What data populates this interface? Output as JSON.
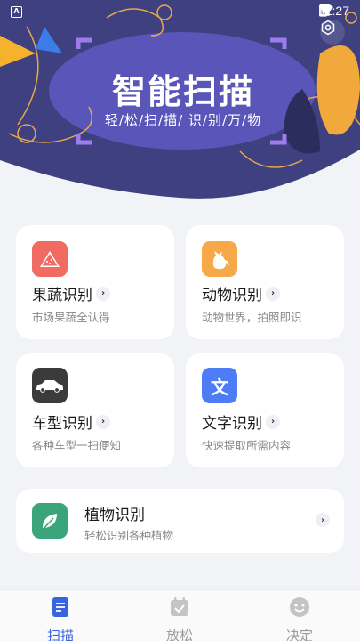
{
  "status": {
    "time": "11:27"
  },
  "hero": {
    "title": "智能扫描",
    "subtitle": "轻/松/扫/描/ 识/别/万/物"
  },
  "cards": [
    {
      "title": "果蔬识别",
      "desc": "市场果蔬全认得",
      "icon": "watermelon-icon",
      "color": "#f26b63"
    },
    {
      "title": "动物识别",
      "desc": "动物世界，拍照即识",
      "icon": "cat-icon",
      "color": "#f7a94a"
    },
    {
      "title": "车型识别",
      "desc": "各种车型一扫便知",
      "icon": "car-icon",
      "color": "#3b3b3b"
    },
    {
      "title": "文字识别",
      "desc": "快速提取所需内容",
      "icon": "text-icon",
      "color": "#4e7cf6",
      "glyph": "文"
    },
    {
      "title": "植物识别",
      "desc": "轻松识别各种植物",
      "icon": "leaf-icon",
      "color": "#3aa57a"
    }
  ],
  "nav": [
    {
      "label": "扫描",
      "active": true,
      "icon": "scan-doc-icon"
    },
    {
      "label": "放松",
      "active": false,
      "icon": "calendar-check-icon"
    },
    {
      "label": "决定",
      "active": false,
      "icon": "smile-icon"
    }
  ],
  "colors": {
    "accent": "#3a63e0",
    "banner_bg": "#3d3f7e",
    "inactive": "#9a9a9a"
  }
}
